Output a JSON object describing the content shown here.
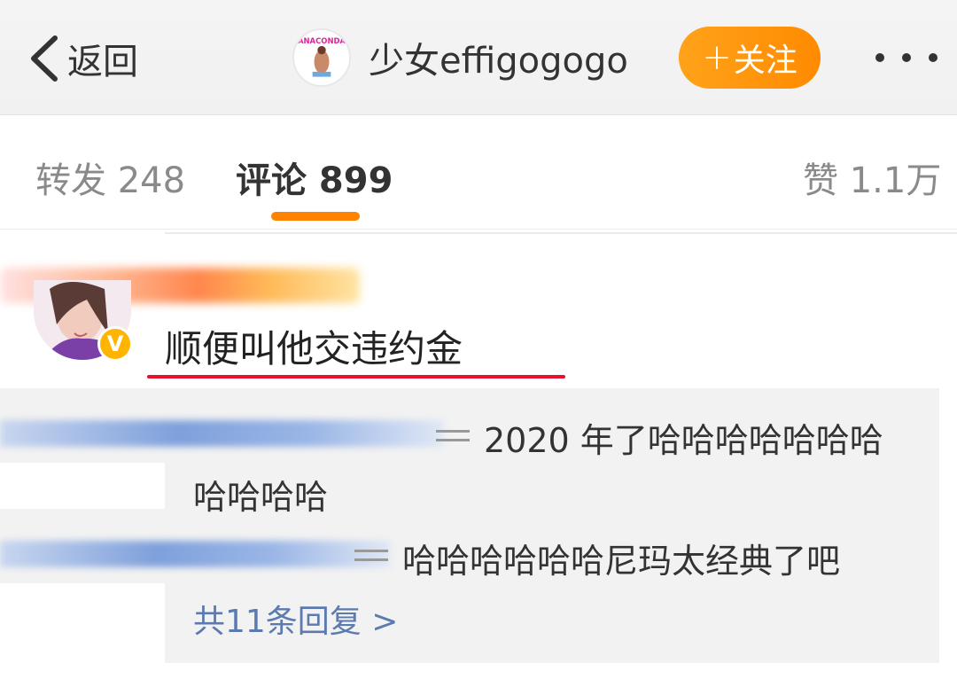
{
  "nav": {
    "back_label": "返回",
    "author_name": "少女effigogogo",
    "avatar_text": "ANACONDA",
    "follow_label": "关注",
    "follow_plus": "+"
  },
  "tabs": [
    {
      "label": "转发 248"
    },
    {
      "label": "评论 899"
    },
    {
      "label": "赞 1.1万"
    }
  ],
  "comment": {
    "text": "顺便叫他交违约金",
    "badge": "V"
  },
  "replies": [
    {
      "text_line1": "2020 年了哈哈哈哈哈哈哈",
      "text_line2": "哈哈哈哈"
    },
    {
      "text_line1": "哈哈哈哈哈哈尼玛太经典了吧"
    }
  ],
  "reply_more": "共11条回复 >",
  "colors": {
    "accent": "#ff8200",
    "link": "#5b7bb0",
    "highlight_line": "#e8102a"
  }
}
